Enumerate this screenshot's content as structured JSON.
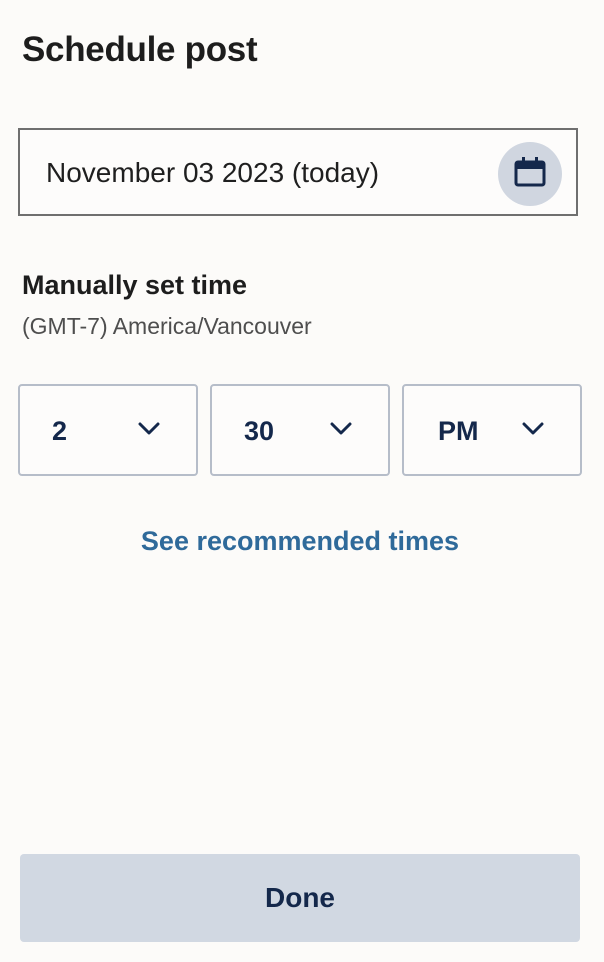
{
  "header": {
    "title": "Schedule post"
  },
  "date": {
    "value": "November 03 2023 (today)",
    "icon": "calendar-icon"
  },
  "time": {
    "label": "Manually set time",
    "timezone": "(GMT-7) America/Vancouver",
    "hour": "2",
    "minute": "30",
    "period": "PM"
  },
  "links": {
    "recommended": "See recommended times"
  },
  "footer": {
    "done_label": "Done"
  },
  "colors": {
    "accent_navy": "#14284b",
    "link_blue": "#2f6a9a",
    "button_bg": "#d1d8e2"
  }
}
